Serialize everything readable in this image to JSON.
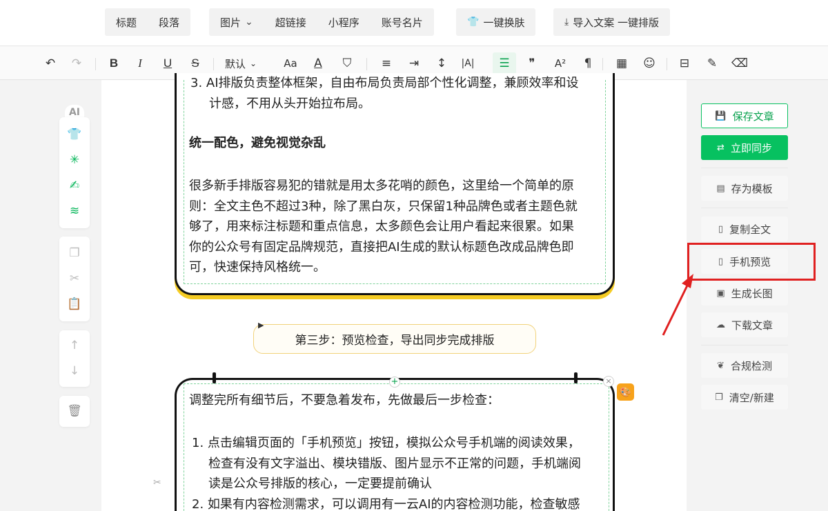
{
  "top_menu": {
    "group1": [
      "标题",
      "段落"
    ],
    "group2": [
      "图片",
      "超链接",
      "小程序",
      "账号名片"
    ],
    "skin_button": "一键换肤",
    "import_button": "导入文案 一键排版"
  },
  "format_toolbar": {
    "font_default": "默认"
  },
  "left_tools": {
    "ai_label": "AI"
  },
  "content": {
    "item3_line1": "3. AI排版负责整体框架，自由布局负责局部个性化调整，兼顾效率和设",
    "item3_line2": "计感，不用从头开始拉布局。",
    "section_title": "统一配色，避免视觉杂乱",
    "para_lines": [
      "很多新手排版容易犯的错就是用太多花哨的颜色，这里给一个简单的原",
      "则：全文主色不超过3种，除了黑白灰，只保留1种品牌色或者主题色就",
      "够了，用来标注标题和重点信息，太多颜色会让用户看起来很累。如果",
      "你的公众号有固定品牌规范，直接把AI生成的默认标题色改成品牌色即",
      "可，快速保持风格统一。"
    ],
    "step3_label": "第三步：预览检查，导出同步完成排版",
    "intro": "调整完所有细节后，不要急着发布，先做最后一步检查：",
    "list_lines": [
      "1. 点击编辑页面的「手机预览」按钮，模拟公众号手机端的阅读效果，",
      "检查有没有文字溢出、模块错版、图片显示不正常的问题，手机端阅",
      "读是公众号排版的核心，一定要提前确认",
      "2. 如果有内容检测需求，可以调用有一云AI的内容检测功能，检查敏感"
    ]
  },
  "right_panel": {
    "save": "保存文章",
    "sync": "立即同步",
    "template": "存为模板",
    "copy": "复制全文",
    "mobile_preview": "手机预览",
    "long_image": "生成长图",
    "download": "下载文章",
    "compliance": "合规检测",
    "clear": "清空/新建"
  },
  "colors": {
    "brand_green": "#07c160",
    "highlight_red": "#e02020",
    "card_accent_yellow": "#f5cc24"
  }
}
